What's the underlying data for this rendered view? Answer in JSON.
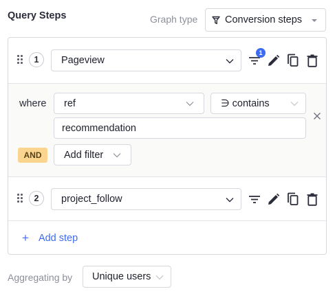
{
  "header": {
    "title": "Query Steps",
    "graph_type_label": "Graph type",
    "graph_type_value": "Conversion steps"
  },
  "steps": [
    {
      "number": "1",
      "event": "Pageview",
      "filter_count": "1"
    },
    {
      "number": "2",
      "event": "project_follow"
    }
  ],
  "filter": {
    "where_label": "where",
    "property": "ref",
    "operator": "∋ contains",
    "value": "recommendation",
    "and_label": "AND",
    "add_filter_label": "Add filter"
  },
  "add_step_label": "Add step",
  "aggregating": {
    "label": "Aggregating by",
    "value": "Unique users"
  },
  "colors": {
    "accent": "#3e6bef",
    "and_badge": "#fbd58f",
    "border": "#d7d8de"
  }
}
